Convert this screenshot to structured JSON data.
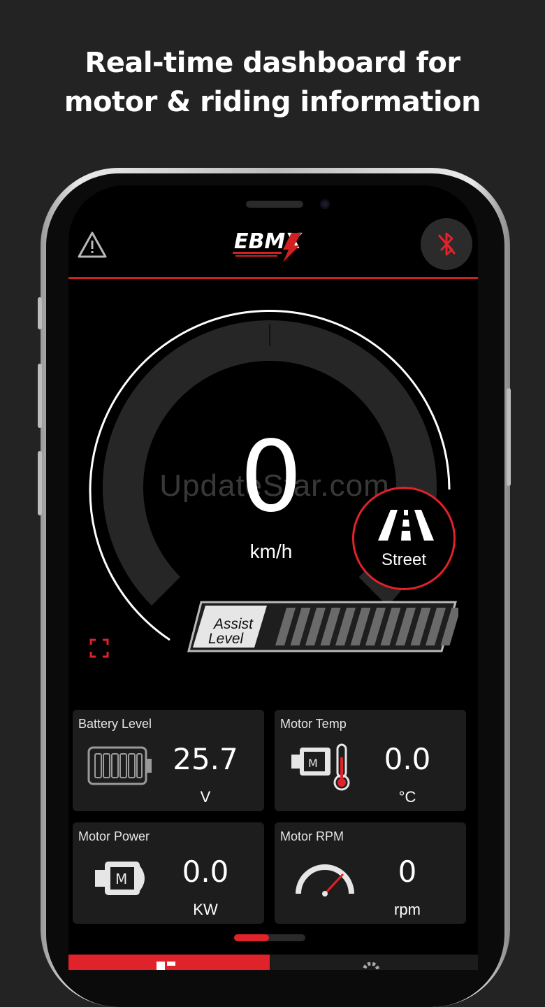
{
  "headline": {
    "line1": "Real-time dashboard for",
    "line2": "motor & riding information"
  },
  "header": {
    "logo_text": "EBMX"
  },
  "speedometer": {
    "speed": "0",
    "unit": "km/h",
    "watermark": "UpdateStar.com"
  },
  "mode": {
    "label": "Street"
  },
  "assist": {
    "line1": "Assist",
    "line2": "Level",
    "segments_total": 12,
    "segments_active": 0
  },
  "cards": {
    "battery": {
      "title": "Battery Level",
      "value": "25.7",
      "unit": "V"
    },
    "motor_temp": {
      "title": "Motor Temp",
      "value": "0.0",
      "unit": "°C"
    },
    "motor_power": {
      "title": "Motor Power",
      "value": "0.0",
      "unit": "KW"
    },
    "motor_rpm": {
      "title": "Motor RPM",
      "value": "0",
      "unit": "rpm"
    }
  },
  "colors": {
    "accent": "#e0222a",
    "background": "#232323",
    "card": "#1d1d1d"
  }
}
